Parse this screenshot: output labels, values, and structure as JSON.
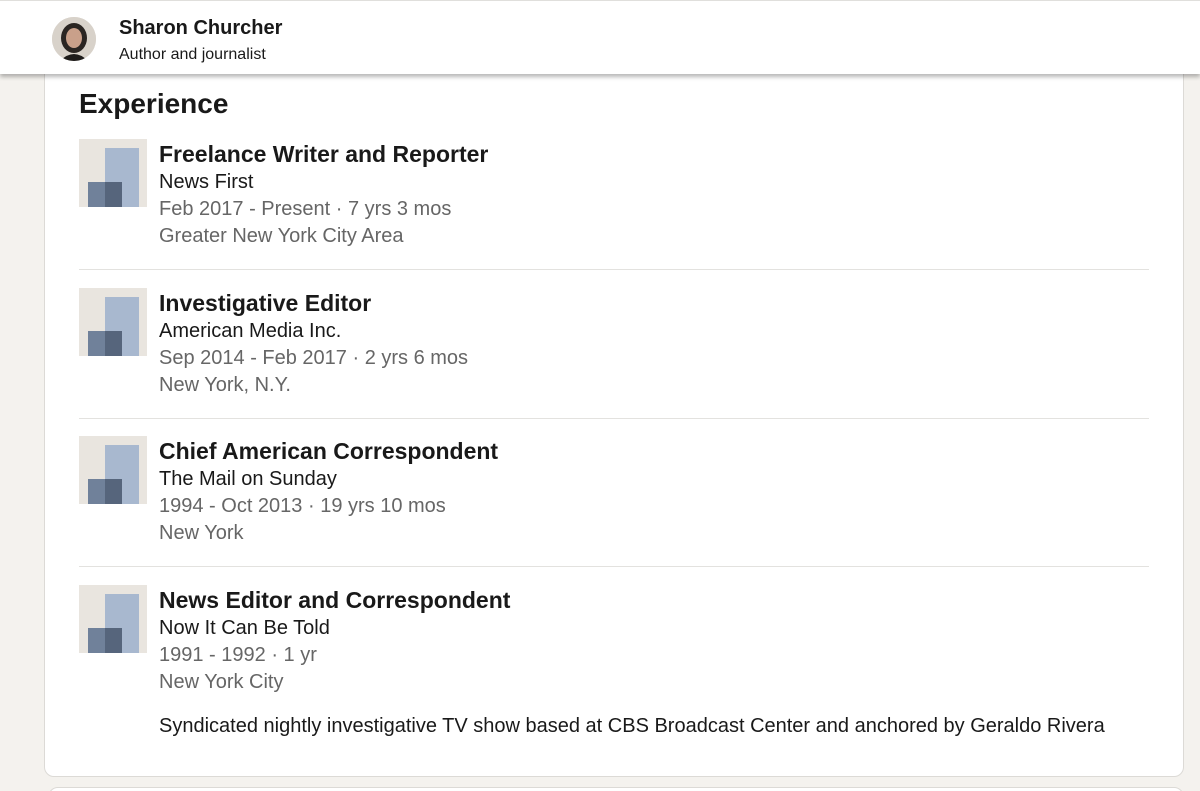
{
  "profile": {
    "name": "Sharon Churcher",
    "headline": "Author and journalist"
  },
  "section": {
    "title": "Experience"
  },
  "experience": [
    {
      "title": "Freelance Writer and Reporter",
      "company": "News First",
      "dates": "Feb 2017 - Present · 7 yrs 3 mos",
      "location": "Greater New York City Area",
      "logo_icon": "company-placeholder-icon"
    },
    {
      "title": "Investigative Editor",
      "company": "American Media Inc.",
      "dates": "Sep 2014 - Feb 2017 · 2 yrs 6 mos",
      "location": "New York, N.Y.",
      "logo_icon": "company-placeholder-icon"
    },
    {
      "title": "Chief American Correspondent",
      "company": "The Mail on Sunday",
      "dates": "1994 - Oct 2013 · 19 yrs 10 mos",
      "location": "New York",
      "logo_icon": "company-placeholder-icon"
    },
    {
      "title": "News Editor and Correspondent",
      "company": "Now It Can Be Told",
      "dates": "1991 - 1992 · 1 yr",
      "location": "New York City",
      "description": "Syndicated nightly investigative TV show based at CBS Broadcast Center and anchored by Geraldo Rivera",
      "logo_icon": "company-placeholder-icon"
    }
  ],
  "colors": {
    "background": "#f4f2ee",
    "card": "#ffffff",
    "text_primary": "#191919",
    "text_secondary": "#666666",
    "logo_light": "#a8b8cf",
    "logo_dark": "#70819a"
  }
}
